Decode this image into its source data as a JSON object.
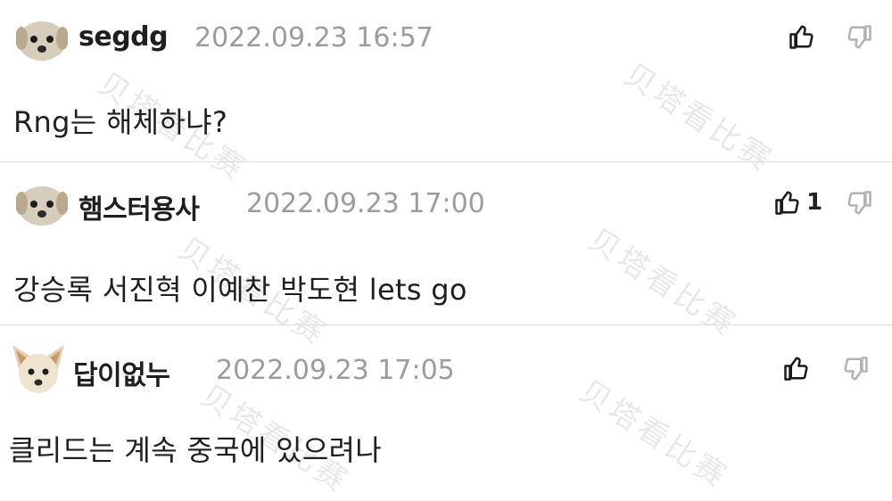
{
  "comments": [
    {
      "username": "segdg",
      "timestamp": "2022.09.23 16:57",
      "text": "Rng는 해체하냐?",
      "like_count": "",
      "avatar": "dog-avatar"
    },
    {
      "username": "햄스터용사",
      "timestamp": "2022.09.23 17:00",
      "text": "강승록 서진혁 이예찬 박도현 lets go",
      "like_count": "1",
      "avatar": "dog-avatar"
    },
    {
      "username": "답이없누",
      "timestamp": "2022.09.23 17:05",
      "text": "클리드는 계속 중국에 있으려나",
      "like_count": "",
      "avatar": "puppy-avatar"
    }
  ],
  "watermark": "贝塔看比赛",
  "icons": {
    "like": "thumbs-up-icon",
    "dislike": "thumbs-down-icon"
  },
  "colors": {
    "timestamp": "#9c9c9c",
    "text": "#1f1f1f",
    "divider": "#dedede"
  }
}
